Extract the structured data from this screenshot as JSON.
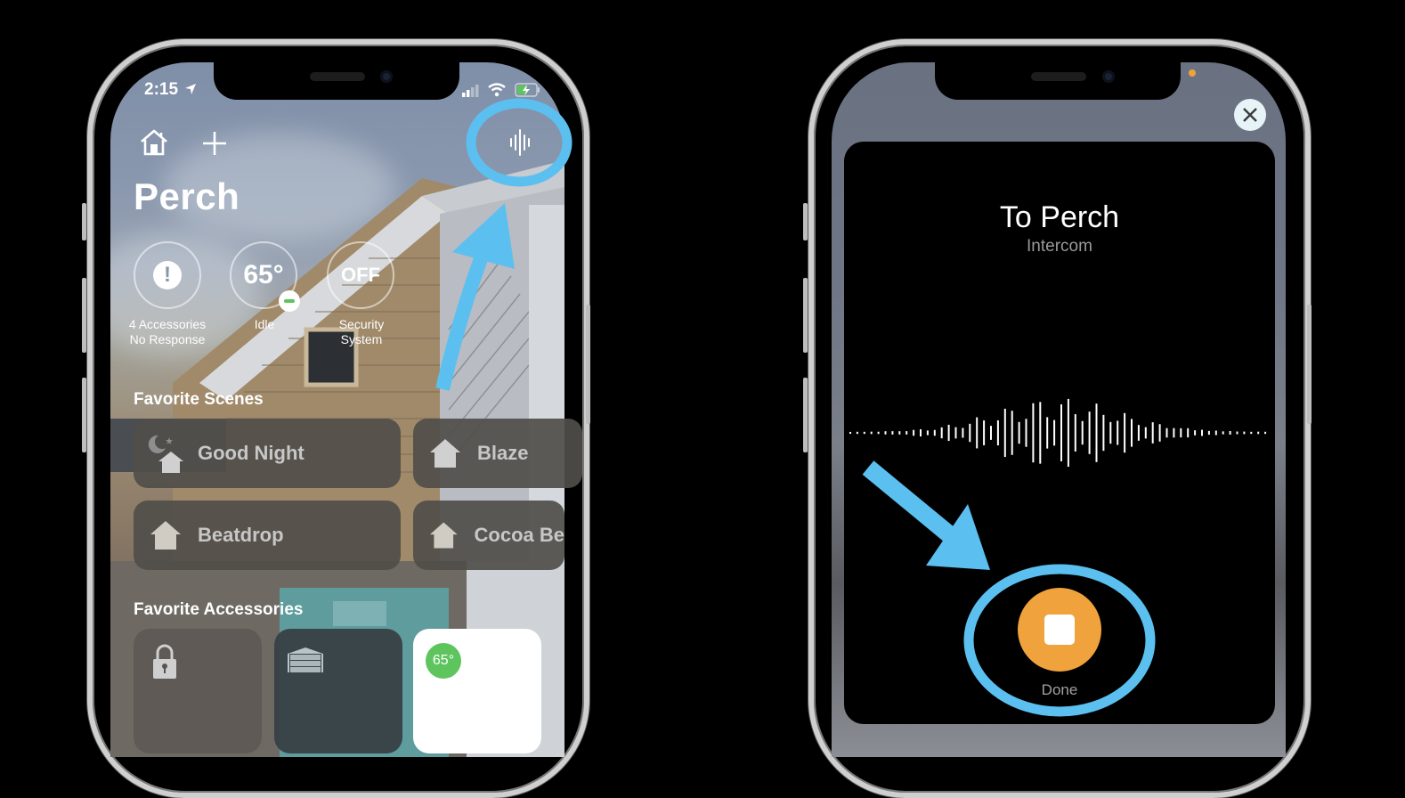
{
  "left_phone": {
    "status_bar": {
      "time": "2:15",
      "location_icon": "location-arrow-icon",
      "signal_icon": "cellular-signal-icon",
      "wifi_icon": "wifi-icon",
      "battery_icon": "battery-charging-icon"
    },
    "toolbar": {
      "home_icon": "home-icon",
      "add_icon": "plus-icon",
      "intercom_icon": "intercom-waveform-icon"
    },
    "home_name": "Perch",
    "status_items": [
      {
        "value": "!",
        "icon": "exclamation-icon",
        "label_line1": "4 Accessories",
        "label_line2": "No Response"
      },
      {
        "value": "65°",
        "badge_icon": "minus-badge-icon",
        "label_line1": "Idle",
        "label_line2": ""
      },
      {
        "value": "OFF",
        "label_line1": "Security",
        "label_line2": "System"
      }
    ],
    "favorite_scenes_title": "Favorite Scenes",
    "scenes": [
      {
        "label": "Good Night",
        "icon": "night-house-icon"
      },
      {
        "label": "Blaze",
        "icon": "house-icon"
      },
      {
        "label": "Beatdrop",
        "icon": "house-icon"
      },
      {
        "label": "Cocoa Be",
        "icon": "house-icon"
      }
    ],
    "favorite_accessories_title": "Favorite Accessories",
    "accessories": [
      {
        "icon": "lock-icon"
      },
      {
        "icon": "garage-door-icon"
      },
      {
        "icon": "thermostat-icon",
        "value": "65°"
      }
    ]
  },
  "right_phone": {
    "close_icon": "close-icon",
    "title": "To Perch",
    "subtitle": "Intercom",
    "stop_button_icon": "stop-icon",
    "done_label": "Done",
    "recording_indicator": "orange-dot"
  },
  "annotations": {
    "highlight_color": "#5bc0f0",
    "accent_orange": "#f0a33c",
    "thermostat_green": "#5ec45e"
  }
}
